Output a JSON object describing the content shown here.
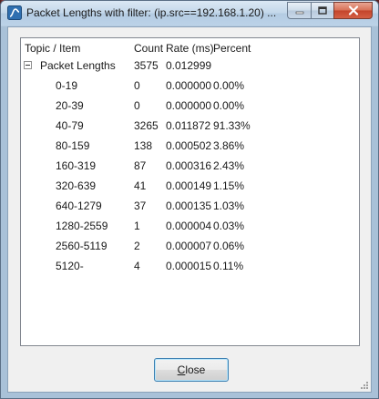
{
  "window": {
    "title": "Packet Lengths with filter: (ip.src==192.168.1.20) ..."
  },
  "list": {
    "columns": [
      "Topic / Item",
      "Count",
      "Rate (ms)",
      "Percent"
    ],
    "root": {
      "topic": "Packet Lengths",
      "count": "3575",
      "rate": "0.012999",
      "percent": ""
    },
    "rows": [
      {
        "topic": "0-19",
        "count": "0",
        "rate": "0.000000",
        "percent": "0.00%"
      },
      {
        "topic": "20-39",
        "count": "0",
        "rate": "0.000000",
        "percent": "0.00%"
      },
      {
        "topic": "40-79",
        "count": "3265",
        "rate": "0.011872",
        "percent": "91.33%"
      },
      {
        "topic": "80-159",
        "count": "138",
        "rate": "0.000502",
        "percent": "3.86%"
      },
      {
        "topic": "160-319",
        "count": "87",
        "rate": "0.000316",
        "percent": "2.43%"
      },
      {
        "topic": "320-639",
        "count": "41",
        "rate": "0.000149",
        "percent": "1.15%"
      },
      {
        "topic": "640-1279",
        "count": "37",
        "rate": "0.000135",
        "percent": "1.03%"
      },
      {
        "topic": "1280-2559",
        "count": "1",
        "rate": "0.000004",
        "percent": "0.03%"
      },
      {
        "topic": "2560-5119",
        "count": "2",
        "rate": "0.000007",
        "percent": "0.06%"
      },
      {
        "topic": "5120-",
        "count": "4",
        "rate": "0.000015",
        "percent": "0.11%"
      }
    ]
  },
  "buttons": {
    "close_mnemonic": "C",
    "close_rest": "lose"
  },
  "icons": {
    "app": "wireshark-icon",
    "minimize": "minimize-icon",
    "maximize": "maximize-icon",
    "close": "close-icon",
    "collapse": "collapse-minus-icon",
    "grip": "resize-grip-icon"
  },
  "colors": {
    "titlebar": "#c3d7ea",
    "close_button": "#c3442a",
    "client_bg": "#f0f0f0",
    "list_bg": "#ffffff",
    "button_focus": "#3c7fb1"
  }
}
